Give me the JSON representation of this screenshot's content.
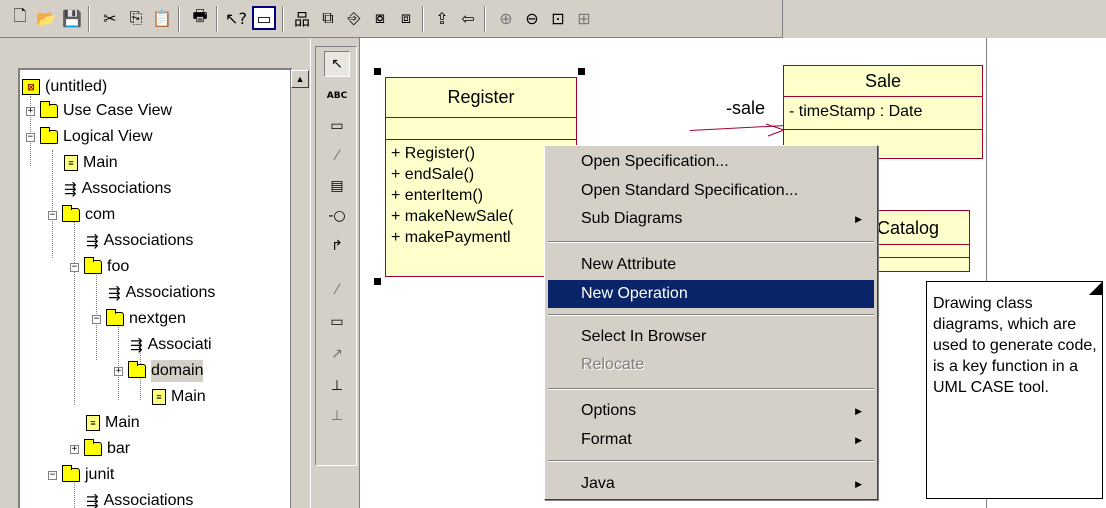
{
  "toolbar": {
    "buttons": [
      {
        "name": "new-icon",
        "glyph": "🗋"
      },
      {
        "name": "open-icon",
        "glyph": "📂"
      },
      {
        "name": "save-icon",
        "glyph": "💾"
      },
      {
        "name": "cut-icon",
        "glyph": "✂"
      },
      {
        "name": "copy-icon",
        "glyph": "⎘"
      },
      {
        "name": "paste-icon",
        "glyph": "📋"
      },
      {
        "name": "print-icon",
        "glyph": "🖶"
      },
      {
        "name": "context-help-icon",
        "glyph": "↖?"
      },
      {
        "name": "view-documentation-icon",
        "glyph": "▭"
      },
      {
        "name": "browse-class-diagram-icon",
        "glyph": "品"
      },
      {
        "name": "browse-interaction-diagram-icon",
        "glyph": "⧉"
      },
      {
        "name": "browse-component-diagram-icon",
        "glyph": "⎆"
      },
      {
        "name": "browse-state-diagram-icon",
        "glyph": "⧇"
      },
      {
        "name": "browse-deployment-diagram-icon",
        "glyph": "⧈"
      },
      {
        "name": "browse-parent-icon",
        "glyph": "⇪"
      },
      {
        "name": "browse-previous-diagram-icon",
        "glyph": "⇦"
      },
      {
        "name": "zoom-in-icon",
        "glyph": "⊕"
      },
      {
        "name": "zoom-out-icon",
        "glyph": "⊖"
      },
      {
        "name": "fit-in-window-icon",
        "glyph": "⊡"
      },
      {
        "name": "undo-fit-icon",
        "glyph": "⊞"
      }
    ]
  },
  "tree": {
    "items": [
      {
        "label": "(untitled)",
        "icon": "model-icon"
      },
      {
        "label": "Use Case View",
        "icon": "folder-icon"
      },
      {
        "label": "Logical View",
        "icon": "folder-icon"
      },
      {
        "label": "Main",
        "icon": "class-diagram-icon"
      },
      {
        "label": "Associations",
        "icon": "associations-icon"
      },
      {
        "label": "com",
        "icon": "folder-icon"
      },
      {
        "label": "Associations",
        "icon": "associations-icon"
      },
      {
        "label": "foo",
        "icon": "folder-icon"
      },
      {
        "label": "Associations",
        "icon": "associations-icon"
      },
      {
        "label": "nextgen",
        "icon": "folder-icon"
      },
      {
        "label": "Associati",
        "icon": "associations-icon"
      },
      {
        "label": "domain",
        "icon": "folder-icon"
      },
      {
        "label": "Main",
        "icon": "class-diagram-icon"
      },
      {
        "label": "Main",
        "icon": "class-diagram-icon"
      },
      {
        "label": "bar",
        "icon": "folder-icon"
      },
      {
        "label": "junit",
        "icon": "folder-icon"
      },
      {
        "label": "Associations",
        "icon": "associations-icon"
      }
    ]
  },
  "toolbox": {
    "tools": [
      {
        "name": "selection-tool-icon",
        "glyph": "↖"
      },
      {
        "name": "text-tool-icon",
        "glyph": "ABC"
      },
      {
        "name": "note-tool-icon",
        "glyph": "▭"
      },
      {
        "name": "anchor-note-tool-icon",
        "glyph": "⁄"
      },
      {
        "name": "class-tool-icon",
        "glyph": "▤"
      },
      {
        "name": "interface-tool-icon",
        "glyph": "-○"
      },
      {
        "name": "unidirectional-association-tool-icon",
        "glyph": "↱"
      },
      {
        "name": "association-class-tool-icon",
        "glyph": "⁄"
      },
      {
        "name": "package-tool-icon",
        "glyph": "▭"
      },
      {
        "name": "dependency-tool-icon",
        "glyph": "↗"
      },
      {
        "name": "generalization-tool-icon",
        "glyph": "⊥"
      },
      {
        "name": "realization-tool-icon",
        "glyph": "⊥"
      }
    ]
  },
  "diagram": {
    "register": {
      "name": "Register",
      "operations": [
        "+ Register()",
        "+ endSale()",
        "+ enterItem()",
        "+ makeNewSale(",
        "+ makePaymentl"
      ]
    },
    "sale": {
      "name": "Sale",
      "attributes": [
        "- timeStamp : Date"
      ]
    },
    "catalog": {
      "name_fragment": "Catalog"
    },
    "association_role": "-sale"
  },
  "context_menu": {
    "items": [
      {
        "label": "Open Specification...",
        "submenu": false,
        "disabled": false
      },
      {
        "label": "Open Standard Specification...",
        "submenu": false,
        "disabled": false
      },
      {
        "label": "Sub Diagrams",
        "submenu": true,
        "disabled": false
      },
      {
        "label": "New Attribute",
        "submenu": false,
        "disabled": false
      },
      {
        "label": "New Operation",
        "submenu": false,
        "disabled": false,
        "highlighted": true
      },
      {
        "label": "Select In Browser",
        "submenu": false,
        "disabled": false
      },
      {
        "label": "Relocate",
        "submenu": false,
        "disabled": true
      },
      {
        "label": "Options",
        "submenu": true,
        "disabled": false
      },
      {
        "label": "Format",
        "submenu": true,
        "disabled": false
      },
      {
        "label": "Java",
        "submenu": true,
        "disabled": false
      }
    ]
  },
  "callout": {
    "text": "Drawing class diagrams, which are used to generate code, is a key function in a UML CASE tool."
  },
  "colors": {
    "class_fill": "#ffffcc",
    "class_border": "#a0002e",
    "menu_highlight": "#0a246a",
    "chrome": "#d4d0c8"
  }
}
